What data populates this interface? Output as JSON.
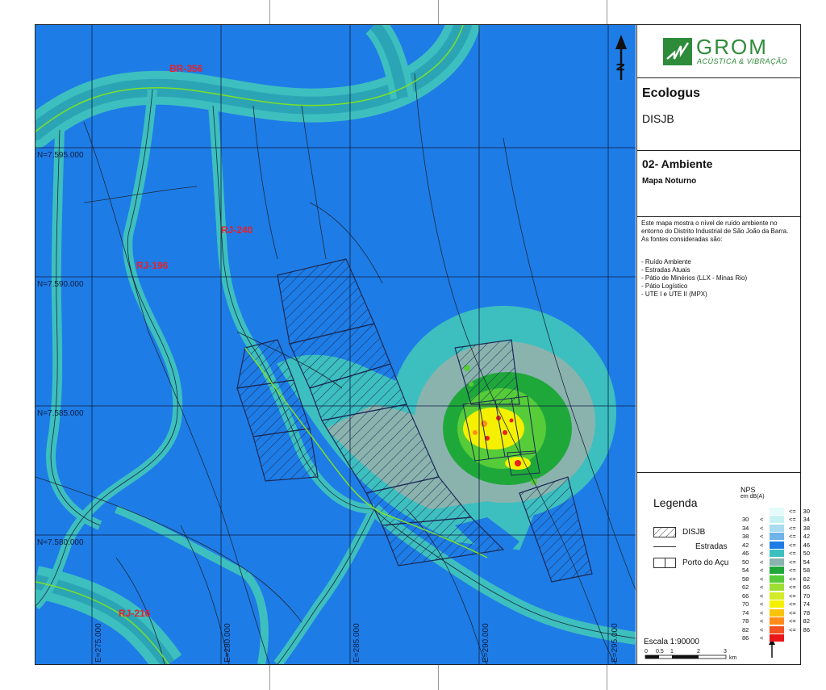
{
  "map": {
    "roads": [
      {
        "name": "BR-356"
      },
      {
        "name": "RJ-240"
      },
      {
        "name": "RJ-196"
      },
      {
        "name": "RJ-216"
      }
    ],
    "northings": [
      "N=7.595.000",
      "N=7.590.000",
      "N=7.585.000",
      "N=7.580.000"
    ],
    "eastings": [
      "E=275.000",
      "E=280.000",
      "E=285.000",
      "E=290.000",
      "E=295.000"
    ],
    "north_arrow_label": "N",
    "colors": {
      "water": "#1E7CE6",
      "band_near": "#3DBFBF",
      "band_mid": "#2BA5B5",
      "teal_light": "#5EC8C4",
      "gray_ring": "#8BB3AE",
      "green_dark": "#1FA83A",
      "green_light": "#55CC38",
      "yellow": "#F5F000",
      "orange": "#FF8C1A",
      "red": "#E82020",
      "road_label": "#E8202A"
    }
  },
  "panel": {
    "brand": {
      "name": "GROM",
      "tagline": "ACÚSTICA & VIBRAÇÃO",
      "color": "#2E8B3A"
    },
    "client": "Ecologus",
    "project": "DISJB",
    "map_title": "02- Ambiente",
    "map_subtitle": "Mapa Noturno",
    "description": "Este mapa mostra o nível de ruído ambiente no entorno do Distrito Industrial de São João da Barra. As fontes consideradas são:",
    "sources": [
      "- Ruído Ambiente",
      "- Estradas Atuais",
      "- Pátio de Minérios (LLX - Minas Rio)",
      "- Pátio Logístico",
      "- UTE I e UTE II (MPX)"
    ],
    "legend": {
      "title": "Legenda",
      "items": [
        {
          "label": "DISJB",
          "symbol": "hatch"
        },
        {
          "label": "Estradas",
          "symbol": "line"
        },
        {
          "label": "Porto do Açu",
          "symbol": "box"
        }
      ]
    },
    "nps": {
      "title": "NPS",
      "unit": "em dB(A)",
      "classes": [
        {
          "from": "",
          "lt": "",
          "le": "<=",
          "to": "30",
          "color": "#E4FBFB"
        },
        {
          "from": "30",
          "lt": "<",
          "le": "<=",
          "to": "34",
          "color": "#C6F1F3"
        },
        {
          "from": "34",
          "lt": "<",
          "le": "<=",
          "to": "38",
          "color": "#A8DCEE"
        },
        {
          "from": "38",
          "lt": "<",
          "le": "<=",
          "to": "42",
          "color": "#6FB3E8"
        },
        {
          "from": "42",
          "lt": "<",
          "le": "<=",
          "to": "46",
          "color": "#1E7CE6"
        },
        {
          "from": "46",
          "lt": "<",
          "le": "<=",
          "to": "50",
          "color": "#3DBFBF"
        },
        {
          "from": "50",
          "lt": "<",
          "le": "<=",
          "to": "54",
          "color": "#8BB3AE"
        },
        {
          "from": "54",
          "lt": "<",
          "le": "<=",
          "to": "58",
          "color": "#1FA83A"
        },
        {
          "from": "58",
          "lt": "<",
          "le": "<=",
          "to": "62",
          "color": "#55CC38"
        },
        {
          "from": "62",
          "lt": "<",
          "le": "<=",
          "to": "66",
          "color": "#9EDD32"
        },
        {
          "from": "66",
          "lt": "<",
          "le": "<=",
          "to": "70",
          "color": "#D3EA2A"
        },
        {
          "from": "70",
          "lt": "<",
          "le": "<=",
          "to": "74",
          "color": "#F5F000"
        },
        {
          "from": "74",
          "lt": "<",
          "le": "<=",
          "to": "78",
          "color": "#F8C40A"
        },
        {
          "from": "78",
          "lt": "<",
          "le": "<=",
          "to": "82",
          "color": "#FF8C1A"
        },
        {
          "from": "82",
          "lt": "<",
          "le": "<=",
          "to": "86",
          "color": "#F25220"
        },
        {
          "from": "86",
          "lt": "<",
          "le": "",
          "to": "",
          "color": "#E81818"
        }
      ]
    },
    "scale": {
      "label": "Escala 1:90000",
      "ticks": [
        "0",
        "0.5",
        "1",
        "2",
        "3"
      ],
      "unit": "km"
    }
  }
}
